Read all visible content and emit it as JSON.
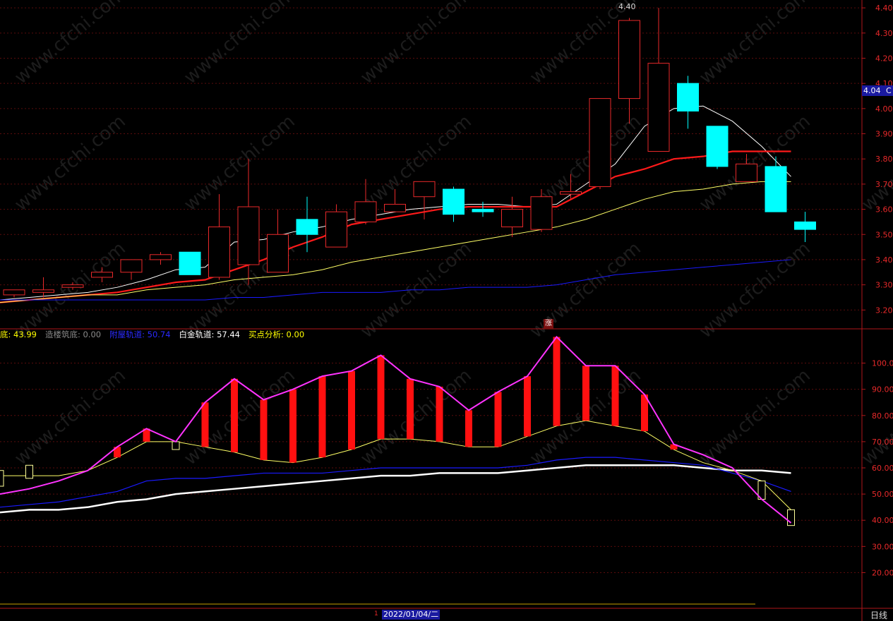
{
  "watermark": "www.cfchi.com",
  "period_label": "日线",
  "cursor_date": "2022/01/04/二",
  "cursor_marker": "1",
  "current_price_label": "4.04",
  "current_price_suffix": "C",
  "peak_label": "4.40",
  "zhang_badge": "涨",
  "indicator_header": [
    {
      "name": "底",
      "value": "43.99",
      "color": "#ffff00"
    },
    {
      "name": "造楼筑底",
      "value": "0.00",
      "color": "#8a8a8a"
    },
    {
      "name": "附屋轨道",
      "value": "50.74",
      "color": "#2a2aff"
    },
    {
      "name": "白金轨道",
      "value": "57.44",
      "color": "#ffffff"
    },
    {
      "name": "买点分析",
      "value": "0.00",
      "color": "#ffff00"
    }
  ],
  "colors": {
    "up": "#e8292a",
    "down": "#00ffff",
    "ma_white": "#ffffff",
    "ma_red": "#ff1a1a",
    "ma_yellow": "#ffff66",
    "ma_blue": "#1a1aff",
    "axis": "#b0161a"
  },
  "chart_data": [
    {
      "type": "candlestick",
      "title": "",
      "y_ticks": [
        "3.20",
        "3.30",
        "3.40",
        "3.50",
        "3.60",
        "3.70",
        "3.80",
        "3.90",
        "4.00",
        "4.10",
        "4.20",
        "4.30",
        "4.40"
      ],
      "ylim": [
        3.17,
        4.42
      ],
      "x": [
        1,
        2,
        3,
        4,
        5,
        6,
        7,
        8,
        9,
        10,
        11,
        12,
        13,
        14,
        15,
        16,
        17,
        18,
        19,
        20,
        21,
        22,
        23,
        24,
        25,
        26
      ],
      "open": [
        3.26,
        3.27,
        3.29,
        3.33,
        3.35,
        3.4,
        3.43,
        3.33,
        3.38,
        3.35,
        3.56,
        3.45,
        3.55,
        3.59,
        3.65,
        3.68,
        3.6,
        3.53,
        3.52,
        3.66,
        3.69,
        4.04,
        3.83,
        4.1,
        3.93,
        3.71
      ],
      "close": [
        3.28,
        3.28,
        3.3,
        3.35,
        3.4,
        3.42,
        3.34,
        3.53,
        3.61,
        3.5,
        3.5,
        3.59,
        3.63,
        3.62,
        3.71,
        3.58,
        3.59,
        3.6,
        3.65,
        3.67,
        4.04,
        4.35,
        4.18,
        3.99,
        3.77,
        3.78
      ],
      "high": [
        3.28,
        3.33,
        3.31,
        3.37,
        3.4,
        3.43,
        3.43,
        3.66,
        3.8,
        3.6,
        3.65,
        3.62,
        3.72,
        3.68,
        3.71,
        3.69,
        3.63,
        3.65,
        3.68,
        3.74,
        4.04,
        4.36,
        4.4,
        4.13,
        3.93,
        3.82
      ],
      "low": [
        3.25,
        3.25,
        3.28,
        3.31,
        3.32,
        3.38,
        3.34,
        3.32,
        3.3,
        3.48,
        3.43,
        3.55,
        3.54,
        3.6,
        3.56,
        3.55,
        3.57,
        3.49,
        3.51,
        3.64,
        3.68,
        3.94,
        3.83,
        3.92,
        3.76,
        3.71
      ],
      "extra_candles": [
        {
          "x": 27,
          "open": 3.77,
          "close": 3.59,
          "high": 3.81,
          "low": 3.59
        },
        {
          "x": 28,
          "open": 3.55,
          "close": 3.52,
          "high": 3.59,
          "low": 3.47
        }
      ],
      "series": [
        {
          "name": "",
          "color": "#ffffff",
          "values": [
            3.24,
            3.25,
            3.26,
            3.27,
            3.29,
            3.32,
            3.36,
            3.37,
            3.47,
            3.48,
            3.51,
            3.53,
            3.56,
            3.58,
            3.6,
            3.61,
            3.62,
            3.62,
            3.61,
            3.62,
            3.7,
            3.78,
            3.93,
            4.0,
            4.01,
            3.95,
            3.85,
            3.73
          ]
        },
        {
          "name": "",
          "color": "#ff1a1a",
          "values": [
            3.23,
            3.24,
            3.25,
            3.26,
            3.27,
            3.29,
            3.31,
            3.32,
            3.36,
            3.4,
            3.45,
            3.49,
            3.54,
            3.56,
            3.58,
            3.6,
            3.61,
            3.61,
            3.61,
            3.61,
            3.67,
            3.73,
            3.76,
            3.8,
            3.81,
            3.83,
            3.83,
            3.83
          ]
        },
        {
          "name": "",
          "color": "#ffff66",
          "values": [
            3.23,
            3.24,
            3.25,
            3.26,
            3.26,
            3.28,
            3.29,
            3.3,
            3.32,
            3.33,
            3.34,
            3.36,
            3.39,
            3.41,
            3.43,
            3.45,
            3.47,
            3.49,
            3.51,
            3.53,
            3.56,
            3.6,
            3.64,
            3.67,
            3.68,
            3.7,
            3.71,
            3.71
          ]
        },
        {
          "name": "",
          "color": "#1a1aff",
          "values": [
            3.24,
            3.24,
            3.24,
            3.24,
            3.24,
            3.24,
            3.24,
            3.24,
            3.25,
            3.25,
            3.26,
            3.27,
            3.27,
            3.27,
            3.28,
            3.28,
            3.29,
            3.29,
            3.29,
            3.3,
            3.32,
            3.34,
            3.35,
            3.36,
            3.37,
            3.38,
            3.39,
            3.4
          ]
        }
      ]
    },
    {
      "type": "bar+line",
      "title": "",
      "y_ticks": [
        "20.00",
        "30.00",
        "40.00",
        "50.00",
        "60.00",
        "70.00",
        "80.00",
        "90.00",
        "100.00"
      ],
      "ylim": [
        8,
        112
      ],
      "x": [
        1,
        2,
        3,
        4,
        5,
        6,
        7,
        8,
        9,
        10,
        11,
        12,
        13,
        14,
        15,
        16,
        17,
        18,
        19,
        20,
        21,
        22,
        23,
        24,
        25,
        26,
        27,
        28
      ],
      "magenta": [
        50,
        52,
        55,
        59,
        68,
        75,
        70,
        85,
        94,
        86,
        90,
        95,
        97,
        103,
        94,
        91,
        82,
        89,
        95,
        110,
        99,
        99,
        88,
        69,
        65,
        60,
        48,
        39
      ],
      "yellow": [
        57,
        57,
        57,
        59,
        64,
        70,
        70,
        68,
        66,
        63,
        62,
        64,
        67,
        71,
        71,
        70,
        68,
        68,
        72,
        76,
        78,
        76,
        74,
        67,
        62,
        59,
        55,
        44
      ],
      "blue": [
        45,
        46,
        47,
        49,
        51,
        55,
        56,
        56,
        57,
        58,
        58,
        58,
        59,
        60,
        60,
        60,
        60,
        60,
        61,
        63,
        64,
        64,
        63,
        62,
        61,
        58,
        55,
        51
      ],
      "white": [
        43,
        44,
        44,
        45,
        47,
        48,
        50,
        51,
        52,
        53,
        54,
        55,
        56,
        57,
        57,
        58,
        58,
        58,
        59,
        60,
        61,
        61,
        61,
        61,
        60,
        59,
        59,
        58
      ],
      "red_bars": [
        {
          "x": 5,
          "top": 68,
          "bottom": 64
        },
        {
          "x": 6,
          "top": 75,
          "bottom": 70
        },
        {
          "x": 8,
          "top": 85,
          "bottom": 68
        },
        {
          "x": 9,
          "top": 94,
          "bottom": 66
        },
        {
          "x": 10,
          "top": 86,
          "bottom": 63
        },
        {
          "x": 11,
          "top": 90,
          "bottom": 62
        },
        {
          "x": 12,
          "top": 95,
          "bottom": 64
        },
        {
          "x": 13,
          "top": 97,
          "bottom": 67
        },
        {
          "x": 14,
          "top": 103,
          "bottom": 71
        },
        {
          "x": 15,
          "top": 94,
          "bottom": 71
        },
        {
          "x": 16,
          "top": 91,
          "bottom": 70
        },
        {
          "x": 17,
          "top": 82,
          "bottom": 68
        },
        {
          "x": 18,
          "top": 89,
          "bottom": 68
        },
        {
          "x": 19,
          "top": 95,
          "bottom": 72
        },
        {
          "x": 20,
          "top": 110,
          "bottom": 76
        },
        {
          "x": 21,
          "top": 99,
          "bottom": 78
        },
        {
          "x": 22,
          "top": 99,
          "bottom": 76
        },
        {
          "x": 23,
          "top": 88,
          "bottom": 74
        },
        {
          "x": 24,
          "top": 69,
          "bottom": 67
        }
      ],
      "hollow_bars": [
        {
          "x": 1,
          "top": 59,
          "bottom": 53
        },
        {
          "x": 2,
          "top": 61,
          "bottom": 56
        },
        {
          "x": 7,
          "top": 70,
          "bottom": 67
        },
        {
          "x": 27,
          "top": 55,
          "bottom": 48
        },
        {
          "x": 28,
          "top": 44,
          "bottom": 38
        }
      ]
    }
  ]
}
